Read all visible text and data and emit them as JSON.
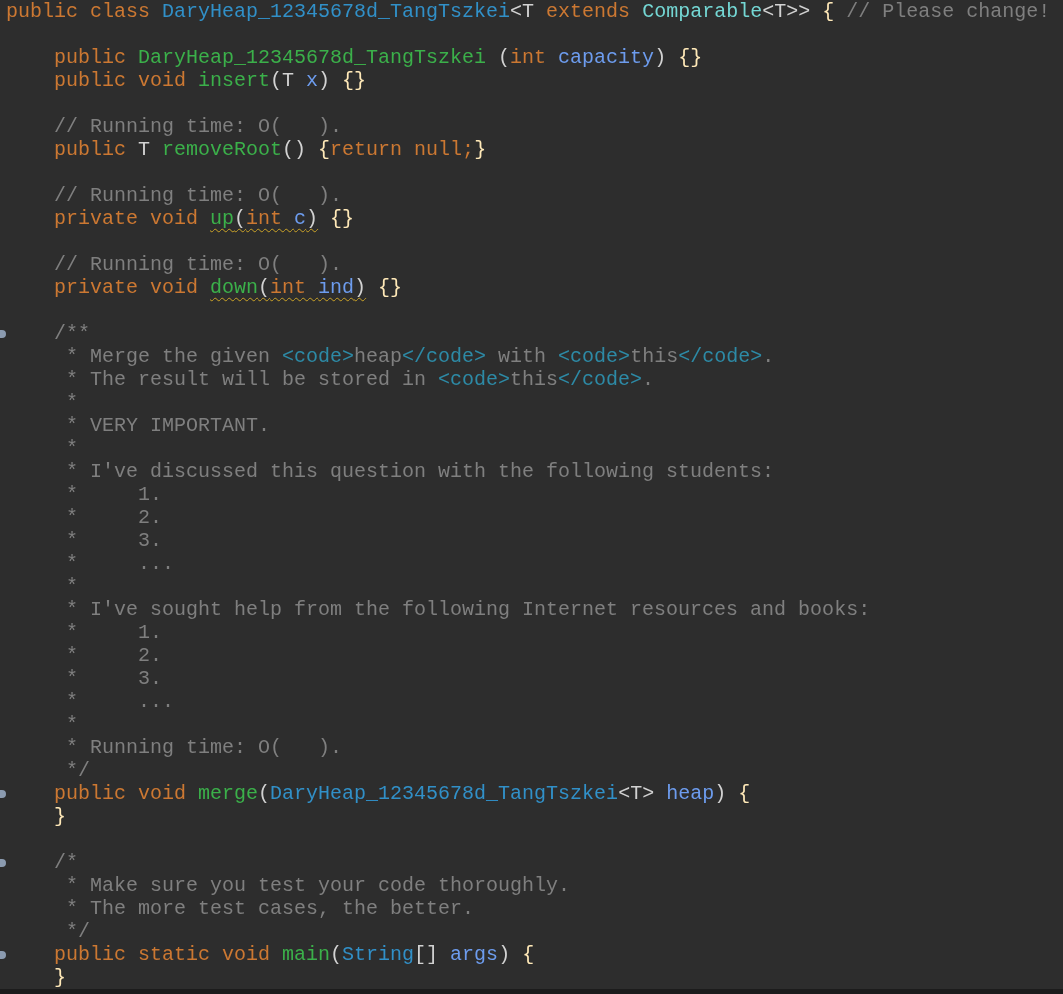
{
  "editor": {
    "lines": [
      {
        "kind": "code",
        "fold": false,
        "tokens": [
          {
            "kind": "keyword",
            "text": "public class "
          },
          {
            "kind": "class",
            "text": "DaryHeap_12345678d_TangTszkei"
          },
          {
            "kind": "plain",
            "text": "<T "
          },
          {
            "kind": "keyword",
            "text": "extends "
          },
          {
            "kind": "interface",
            "text": "Comparable"
          },
          {
            "kind": "plain",
            "text": "<T>> "
          },
          {
            "kind": "brace",
            "text": "{ "
          },
          {
            "kind": "comment",
            "text": "// Please change!"
          }
        ],
        "children": [
          {
            "kind": "blank",
            "fold": false
          },
          {
            "kind": "code",
            "fold": false,
            "tokens": [
              {
                "kind": "keyword",
                "text": "public "
              },
              {
                "kind": "method",
                "text": "DaryHeap_12345678d_TangTszkei"
              },
              {
                "kind": "plain",
                "text": " ("
              },
              {
                "kind": "keyword",
                "text": "int "
              },
              {
                "kind": "param",
                "text": "capacity"
              },
              {
                "kind": "plain",
                "text": ") "
              },
              {
                "kind": "brace",
                "text": "{}"
              }
            ]
          },
          {
            "kind": "code",
            "fold": false,
            "tokens": [
              {
                "kind": "keyword",
                "text": "public void "
              },
              {
                "kind": "method",
                "text": "insert"
              },
              {
                "kind": "plain",
                "text": "(T "
              },
              {
                "kind": "param",
                "text": "x"
              },
              {
                "kind": "plain",
                "text": ") "
              },
              {
                "kind": "brace",
                "text": "{}"
              }
            ]
          },
          {
            "kind": "blank",
            "fold": false
          },
          {
            "kind": "code",
            "fold": false,
            "tokens": [
              {
                "kind": "comment",
                "text": "// Running time: O(   )."
              }
            ]
          },
          {
            "kind": "code",
            "fold": false,
            "tokens": [
              {
                "kind": "keyword",
                "text": "public "
              },
              {
                "kind": "plain",
                "text": "T "
              },
              {
                "kind": "method",
                "text": "removeRoot"
              },
              {
                "kind": "plain",
                "text": "() "
              },
              {
                "kind": "brace",
                "text": "{"
              },
              {
                "kind": "keyword",
                "text": "return null;"
              },
              {
                "kind": "brace",
                "text": "}"
              }
            ]
          },
          {
            "kind": "blank",
            "fold": false
          },
          {
            "kind": "code",
            "fold": false,
            "tokens": [
              {
                "kind": "comment",
                "text": "// Running time: O(   )."
              }
            ]
          },
          {
            "kind": "code",
            "fold": false,
            "tokens": [
              {
                "kind": "keyword",
                "text": "private void "
              },
              {
                "kind": "warning",
                "tokens": [
                  {
                    "kind": "method",
                    "text": "up"
                  },
                  {
                    "kind": "plain",
                    "text": "("
                  },
                  {
                    "kind": "keyword",
                    "text": "int "
                  },
                  {
                    "kind": "param",
                    "text": "c"
                  },
                  {
                    "kind": "plain",
                    "text": ")"
                  }
                ]
              },
              {
                "kind": "brace",
                "text": " {}"
              }
            ]
          },
          {
            "kind": "blank",
            "fold": false
          },
          {
            "kind": "code",
            "fold": false,
            "tokens": [
              {
                "kind": "comment",
                "text": "// Running time: O(   )."
              }
            ]
          },
          {
            "kind": "code",
            "fold": false,
            "tokens": [
              {
                "kind": "keyword",
                "text": "private void "
              },
              {
                "kind": "warning",
                "tokens": [
                  {
                    "kind": "method",
                    "text": "down"
                  },
                  {
                    "kind": "plain",
                    "text": "("
                  },
                  {
                    "kind": "keyword",
                    "text": "int "
                  },
                  {
                    "kind": "param",
                    "text": "ind"
                  },
                  {
                    "kind": "plain",
                    "text": ")"
                  }
                ]
              },
              {
                "kind": "brace",
                "text": " {}"
              }
            ]
          },
          {
            "kind": "blank",
            "fold": false
          },
          {
            "kind": "code",
            "fold": true,
            "tokens": [
              {
                "kind": "comment",
                "text": "/**"
              }
            ]
          },
          {
            "kind": "comment-body",
            "fold": false,
            "tokens": [
              {
                "kind": "comment",
                "text": "* Merge the given "
              },
              {
                "kind": "tag",
                "text": "<code>"
              },
              {
                "kind": "comment",
                "text": "heap"
              },
              {
                "kind": "tag",
                "text": "</code>"
              },
              {
                "kind": "comment",
                "text": " with "
              },
              {
                "kind": "tag",
                "text": "<code>"
              },
              {
                "kind": "comment",
                "text": "this"
              },
              {
                "kind": "tag",
                "text": "</code>"
              },
              {
                "kind": "comment",
                "text": "."
              }
            ]
          },
          {
            "kind": "comment-body",
            "fold": false,
            "tokens": [
              {
                "kind": "comment",
                "text": "* The result will be stored in "
              },
              {
                "kind": "tag",
                "text": "<code>"
              },
              {
                "kind": "comment",
                "text": "this"
              },
              {
                "kind": "tag",
                "text": "</code>"
              },
              {
                "kind": "comment",
                "text": "."
              }
            ]
          },
          {
            "kind": "comment-body",
            "fold": false,
            "tokens": [
              {
                "kind": "comment",
                "text": "*"
              }
            ]
          },
          {
            "kind": "comment-body",
            "fold": false,
            "tokens": [
              {
                "kind": "comment",
                "text": "* VERY IMPORTANT."
              }
            ]
          },
          {
            "kind": "comment-body",
            "fold": false,
            "tokens": [
              {
                "kind": "comment",
                "text": "*"
              }
            ]
          },
          {
            "kind": "comment-body",
            "fold": false,
            "tokens": [
              {
                "kind": "comment",
                "text": "* I've discussed this question with the following students:"
              }
            ]
          },
          {
            "kind": "comment-body",
            "fold": false,
            "tokens": [
              {
                "kind": "comment",
                "text": "*     1."
              }
            ]
          },
          {
            "kind": "comment-body",
            "fold": false,
            "tokens": [
              {
                "kind": "comment",
                "text": "*     2."
              }
            ]
          },
          {
            "kind": "comment-body",
            "fold": false,
            "tokens": [
              {
                "kind": "comment",
                "text": "*     3."
              }
            ]
          },
          {
            "kind": "comment-body",
            "fold": false,
            "tokens": [
              {
                "kind": "comment",
                "text": "*     ..."
              }
            ]
          },
          {
            "kind": "comment-body",
            "fold": false,
            "tokens": [
              {
                "kind": "comment",
                "text": "*"
              }
            ]
          },
          {
            "kind": "comment-body",
            "fold": false,
            "tokens": [
              {
                "kind": "comment",
                "text": "* I've sought help from the following Internet resources and books:"
              }
            ]
          },
          {
            "kind": "comment-body",
            "fold": false,
            "tokens": [
              {
                "kind": "comment",
                "text": "*     1."
              }
            ]
          },
          {
            "kind": "comment-body",
            "fold": false,
            "tokens": [
              {
                "kind": "comment",
                "text": "*     2."
              }
            ]
          },
          {
            "kind": "comment-body",
            "fold": false,
            "tokens": [
              {
                "kind": "comment",
                "text": "*     3."
              }
            ]
          },
          {
            "kind": "comment-body",
            "fold": false,
            "tokens": [
              {
                "kind": "comment",
                "text": "*     ..."
              }
            ]
          },
          {
            "kind": "comment-body",
            "fold": false,
            "tokens": [
              {
                "kind": "comment",
                "text": "*"
              }
            ]
          },
          {
            "kind": "comment-body",
            "fold": false,
            "tokens": [
              {
                "kind": "comment",
                "text": "* Running time: O(   )."
              }
            ]
          },
          {
            "kind": "comment-body",
            "fold": false,
            "tokens": [
              {
                "kind": "comment",
                "text": "*/"
              }
            ]
          },
          {
            "kind": "code",
            "fold": true,
            "tokens": [
              {
                "kind": "keyword",
                "text": "public void "
              },
              {
                "kind": "method",
                "text": "merge"
              },
              {
                "kind": "plain",
                "text": "("
              },
              {
                "kind": "class",
                "text": "DaryHeap_12345678d_TangTszkei"
              },
              {
                "kind": "plain",
                "text": "<T> "
              },
              {
                "kind": "param",
                "text": "heap"
              },
              {
                "kind": "plain",
                "text": ") "
              },
              {
                "kind": "brace",
                "text": "{"
              }
            ]
          },
          {
            "kind": "code",
            "fold": false,
            "tokens": [
              {
                "kind": "brace",
                "text": "}"
              }
            ]
          },
          {
            "kind": "blank",
            "fold": false
          },
          {
            "kind": "code",
            "fold": true,
            "tokens": [
              {
                "kind": "comment",
                "text": "/*"
              }
            ]
          },
          {
            "kind": "comment-body",
            "fold": false,
            "tokens": [
              {
                "kind": "comment",
                "text": "* Make sure you test your code thoroughly."
              }
            ]
          },
          {
            "kind": "comment-body",
            "fold": false,
            "tokens": [
              {
                "kind": "comment",
                "text": "* The more test cases, the better."
              }
            ]
          },
          {
            "kind": "comment-body",
            "fold": false,
            "tokens": [
              {
                "kind": "comment",
                "text": "*/"
              }
            ]
          },
          {
            "kind": "code",
            "fold": true,
            "tokens": [
              {
                "kind": "keyword",
                "text": "public static void "
              },
              {
                "kind": "method",
                "text": "main"
              },
              {
                "kind": "plain",
                "text": "("
              },
              {
                "kind": "class",
                "text": "String"
              },
              {
                "kind": "plain",
                "text": "[] "
              },
              {
                "kind": "param",
                "text": "args"
              },
              {
                "kind": "plain",
                "text": ") "
              },
              {
                "kind": "brace",
                "text": "{"
              }
            ]
          },
          {
            "kind": "code",
            "fold": false,
            "tokens": [
              {
                "kind": "brace",
                "text": "}"
              }
            ]
          }
        ]
      }
    ]
  }
}
